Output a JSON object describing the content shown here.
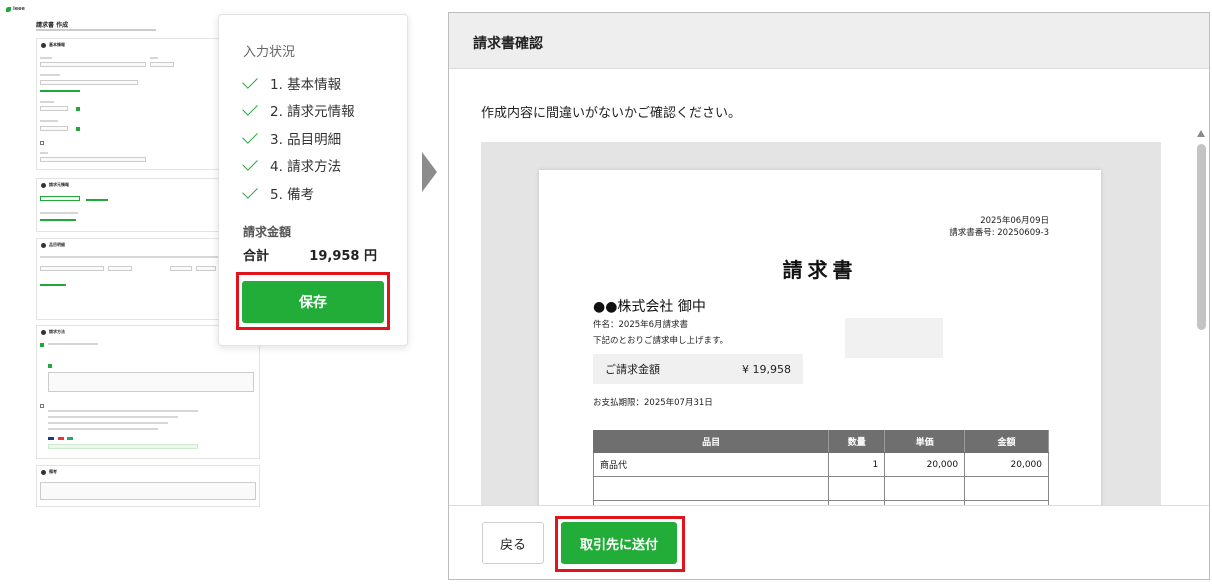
{
  "mini_form": {
    "brand": "ieee",
    "page_title": "請求書 作成",
    "sections": [
      "基本情報",
      "請求元情報",
      "品目明細",
      "請求方法",
      "備考"
    ]
  },
  "status_panel": {
    "title": "入力状況",
    "steps": [
      {
        "label": "1. 基本情報",
        "done": true
      },
      {
        "label": "2. 請求元情報",
        "done": true
      },
      {
        "label": "3. 品目明細",
        "done": true
      },
      {
        "label": "4. 請求方法",
        "done": true
      },
      {
        "label": "5. 備考",
        "done": true
      }
    ],
    "amount_label": "請求金額",
    "total_label": "合計",
    "total_value": "19,958 円",
    "save_label": "保存"
  },
  "modal": {
    "title": "請求書確認",
    "lead": "作成内容に間違いがないかご確認ください。",
    "back_label": "戻る",
    "send_label": "取引先に送付"
  },
  "invoice": {
    "date": "2025年06月09日",
    "number": "請求書番号: 20250609-3",
    "title": "請求書",
    "client": "●●株式会社 御中",
    "subject": "件名：2025年6月請求書",
    "note": "下記のとおりご請求申し上げます。",
    "amount_label": "ご請求金額",
    "amount_value": "¥ 19,958",
    "due": "お支払期限：2025年07月31日",
    "table": {
      "headers": [
        "品目",
        "数量",
        "単価",
        "金額"
      ],
      "rows": [
        [
          "商品代",
          "1",
          "20,000",
          "20,000"
        ],
        [
          "",
          "",
          "",
          ""
        ],
        [
          "",
          "",
          "",
          ""
        ]
      ]
    }
  },
  "colors": {
    "accent_green": "#22ac38",
    "highlight_red": "#e1141b",
    "table_header": "#6f6f6f"
  }
}
